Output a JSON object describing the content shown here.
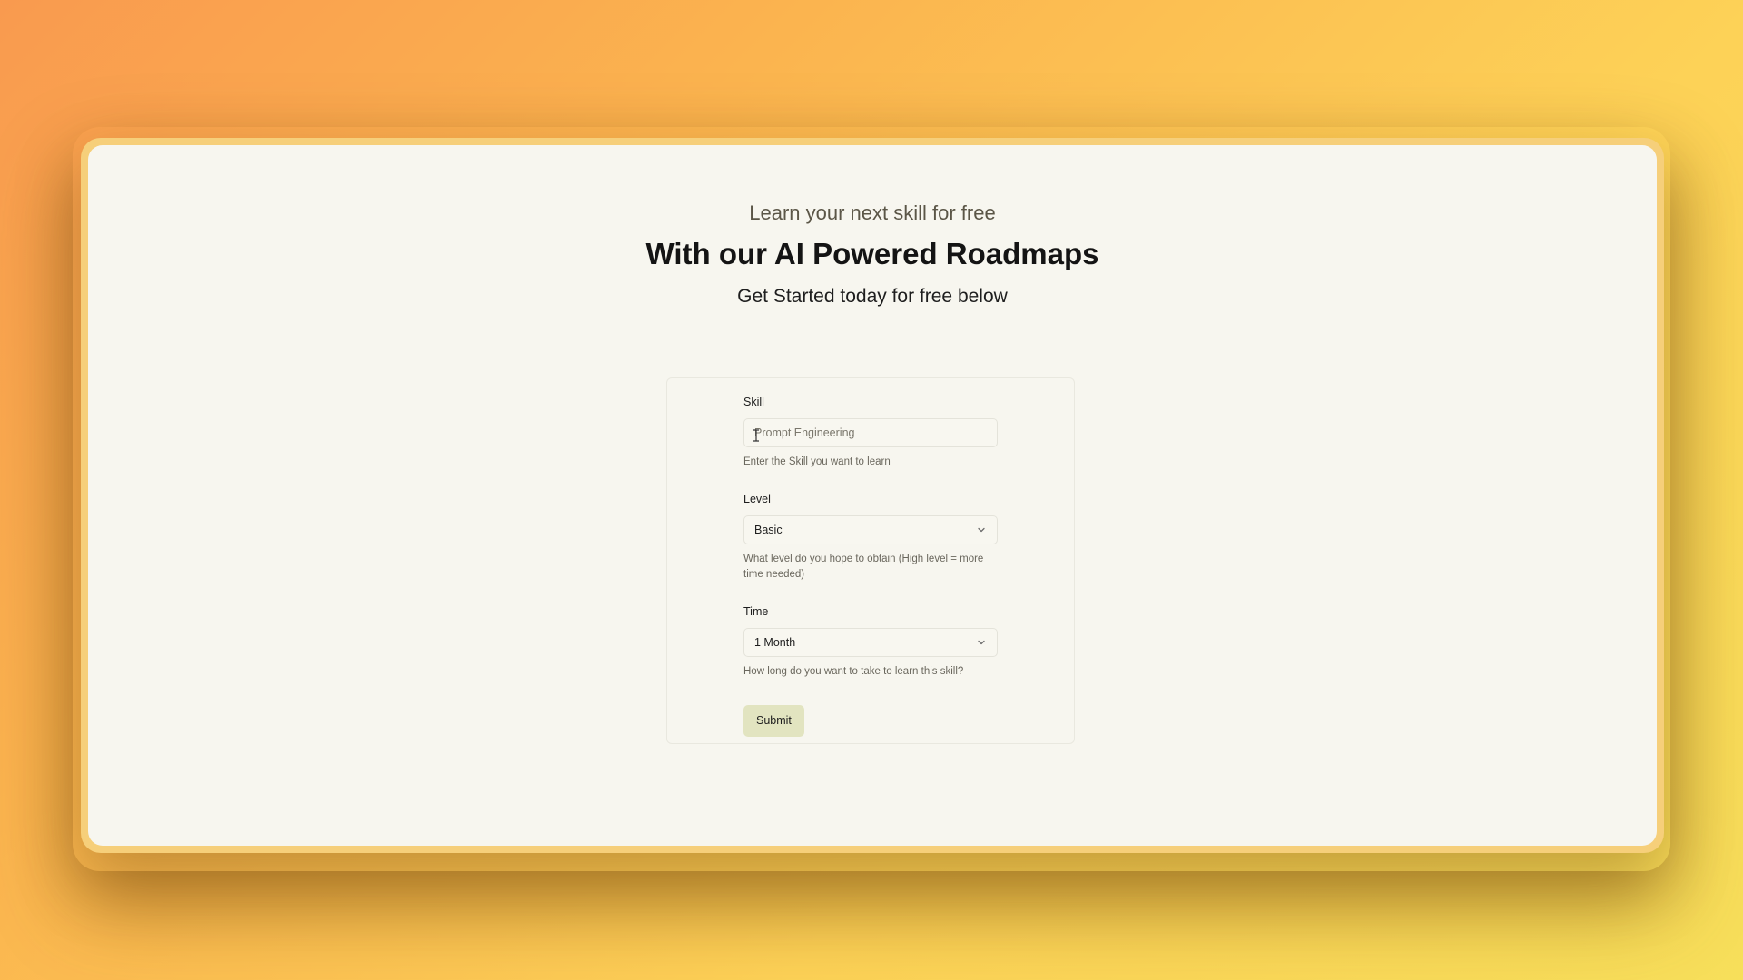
{
  "hero": {
    "eyebrow": "Learn your next skill for free",
    "title": "With our AI Powered Roadmaps",
    "subtitle": "Get Started today for free below"
  },
  "form": {
    "skill": {
      "label": "Skill",
      "placeholder": "Prompt Engineering",
      "help": "Enter the Skill you want to learn"
    },
    "level": {
      "label": "Level",
      "selected": "Basic",
      "help": "What level do you hope to obtain (High level = more time needed)"
    },
    "time": {
      "label": "Time",
      "selected": "1 Month",
      "help": "How long do you want to take to learn this skill?"
    },
    "submit_label": "Submit"
  },
  "colors": {
    "background_gradient_start": "#f99a4f",
    "background_gradient_end": "#f7df5a",
    "window_background": "#f7f6ef",
    "submit_button": "#e2e4c0"
  },
  "icons": {
    "select_chevron": "chevron-down-icon",
    "text_cursor": "text-cursor-icon"
  }
}
